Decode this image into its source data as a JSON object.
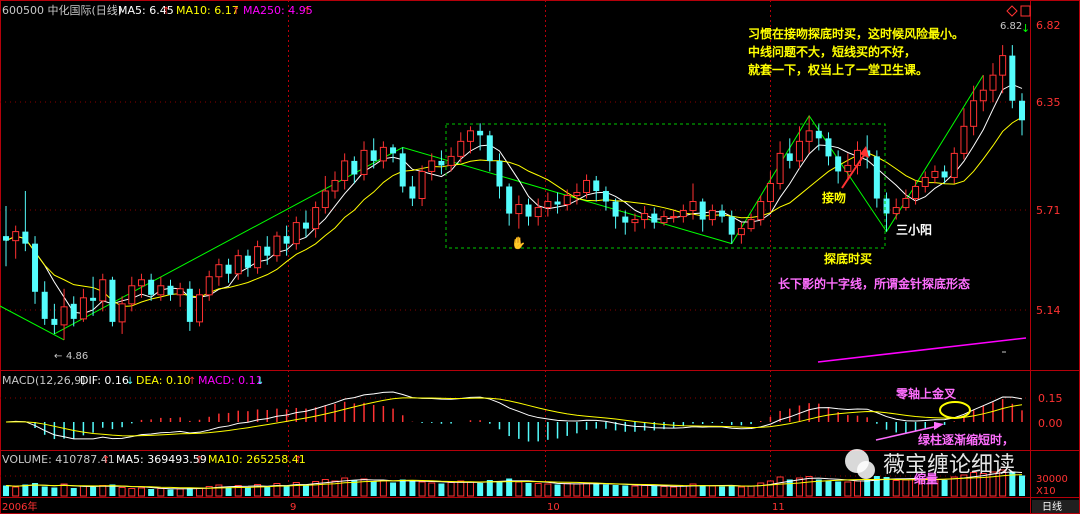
{
  "header": {
    "code_name": "600500 中化国际(日线)",
    "ma5": "MA5: 6.45",
    "ma10": "MA10: 6.17",
    "ma250": "MA250: 4.95"
  },
  "price_axis": [
    "6.82",
    "6.35",
    "5.71",
    "5.14"
  ],
  "low_label": "4.86",
  "annotations": {
    "note_lines": [
      "习惯在接吻探底时买，这时候风险最小。",
      "中线问题不大，短线买的不好，",
      "就套一下，权当上了一堂卫生课。"
    ],
    "kiss": "接吻",
    "three_small_yang": "三小阳",
    "bottom_buy": "探底时买",
    "doji_note": "长下影的十字线，所谓金针探底形态",
    "zero_axis_cross": "零轴上金叉",
    "green_shrink": "绿柱逐渐缩短时，",
    "shrink_volume": "缩量",
    "watermark": "薇宝缠论细读"
  },
  "macd": {
    "title": "MACD(12,26,9)",
    "dif": "DIF: 0.16",
    "dea": "DEA: 0.10",
    "macd": "MACD: 0.11",
    "axis": [
      "0.15",
      "0.00"
    ]
  },
  "volume": {
    "title": "VOLUME: 410787.41",
    "ma5": "MA5: 369493.59",
    "ma10": "MA10: 265258.41",
    "axis": [
      "30000",
      "X10"
    ]
  },
  "months": [
    "2006年",
    "9",
    "10",
    "11"
  ],
  "period": "日线",
  "colors": {
    "up": "#ff3232",
    "down": "#54fcfc",
    "ma5": "#ffffff",
    "ma10": "#ffff00",
    "ma250": "#ff00ff",
    "trend": "#00ff00",
    "annot": "#ffff00",
    "pink": "#ff6eff"
  },
  "chart_data": {
    "type": "candlestick",
    "ylim": [
      4.7,
      7.0
    ],
    "candles": [
      [
        5.55,
        5.52,
        5.75,
        5.35
      ],
      [
        5.52,
        5.58,
        5.62,
        5.4
      ],
      [
        5.58,
        5.5,
        5.85,
        5.45
      ],
      [
        5.5,
        5.18,
        5.55,
        5.1
      ],
      [
        5.18,
        5.0,
        5.25,
        4.96
      ],
      [
        5.0,
        4.96,
        5.1,
        4.9
      ],
      [
        4.96,
        5.08,
        5.2,
        4.86
      ],
      [
        5.1,
        5.0,
        5.15,
        4.95
      ],
      [
        5.0,
        5.14,
        5.2,
        4.98
      ],
      [
        5.14,
        5.12,
        5.28,
        5.02
      ],
      [
        5.12,
        5.26,
        5.3,
        5.05
      ],
      [
        5.26,
        4.98,
        5.28,
        4.95
      ],
      [
        4.98,
        5.1,
        5.15,
        4.9
      ],
      [
        5.1,
        5.22,
        5.28,
        5.05
      ],
      [
        5.22,
        5.26,
        5.3,
        5.14
      ],
      [
        5.26,
        5.16,
        5.3,
        5.12
      ],
      [
        5.16,
        5.22,
        5.28,
        5.12
      ],
      [
        5.22,
        5.16,
        5.26,
        5.12
      ],
      [
        5.16,
        5.2,
        5.24,
        5.08
      ],
      [
        5.2,
        4.98,
        5.25,
        4.92
      ],
      [
        4.98,
        5.16,
        5.2,
        4.95
      ],
      [
        5.16,
        5.28,
        5.32,
        5.12
      ],
      [
        5.28,
        5.36,
        5.4,
        5.22
      ],
      [
        5.36,
        5.3,
        5.4,
        5.24
      ],
      [
        5.3,
        5.42,
        5.46,
        5.26
      ],
      [
        5.42,
        5.34,
        5.46,
        5.28
      ],
      [
        5.34,
        5.48,
        5.52,
        5.3
      ],
      [
        5.48,
        5.42,
        5.55,
        5.36
      ],
      [
        5.42,
        5.55,
        5.58,
        5.38
      ],
      [
        5.55,
        5.5,
        5.62,
        5.42
      ],
      [
        5.5,
        5.64,
        5.68,
        5.46
      ],
      [
        5.64,
        5.6,
        5.72,
        5.54
      ],
      [
        5.6,
        5.74,
        5.78,
        5.54
      ],
      [
        5.74,
        5.85,
        5.95,
        5.7
      ],
      [
        5.85,
        5.92,
        5.98,
        5.8
      ],
      [
        5.92,
        6.05,
        6.1,
        5.86
      ],
      [
        6.05,
        5.96,
        6.08,
        5.9
      ],
      [
        5.96,
        6.12,
        6.18,
        5.92
      ],
      [
        6.12,
        6.05,
        6.2,
        6.0
      ],
      [
        6.05,
        6.14,
        6.18,
        6.0
      ],
      [
        6.14,
        6.1,
        6.16,
        6.04
      ],
      [
        6.1,
        5.88,
        6.14,
        5.84
      ],
      [
        5.88,
        5.8,
        5.95,
        5.75
      ],
      [
        5.8,
        5.98,
        6.02,
        5.75
      ],
      [
        5.98,
        6.05,
        6.1,
        5.92
      ],
      [
        6.05,
        6.02,
        6.12,
        5.96
      ],
      [
        6.02,
        6.08,
        6.14,
        5.98
      ],
      [
        6.08,
        6.18,
        6.24,
        6.04
      ],
      [
        6.18,
        6.25,
        6.28,
        6.1
      ],
      [
        6.25,
        6.22,
        6.3,
        6.12
      ],
      [
        6.22,
        6.05,
        6.25,
        5.98
      ],
      [
        6.05,
        5.88,
        6.1,
        5.8
      ],
      [
        5.88,
        5.7,
        5.9,
        5.62
      ],
      [
        5.7,
        5.76,
        5.82,
        5.6
      ],
      [
        5.76,
        5.68,
        5.8,
        5.62
      ],
      [
        5.68,
        5.74,
        5.8,
        5.62
      ],
      [
        5.74,
        5.78,
        5.84,
        5.68
      ],
      [
        5.78,
        5.76,
        5.84,
        5.7
      ],
      [
        5.76,
        5.82,
        5.86,
        5.72
      ],
      [
        5.82,
        5.84,
        5.9,
        5.76
      ],
      [
        5.84,
        5.92,
        5.96,
        5.8
      ],
      [
        5.92,
        5.85,
        5.95,
        5.78
      ],
      [
        5.85,
        5.78,
        5.88,
        5.72
      ],
      [
        5.78,
        5.68,
        5.8,
        5.6
      ],
      [
        5.68,
        5.64,
        5.72,
        5.56
      ],
      [
        5.64,
        5.66,
        5.7,
        5.58
      ],
      [
        5.66,
        5.7,
        5.75,
        5.6
      ],
      [
        5.7,
        5.64,
        5.74,
        5.6
      ],
      [
        5.64,
        5.68,
        5.72,
        5.62
      ],
      [
        5.68,
        5.68,
        5.72,
        5.64
      ],
      [
        5.68,
        5.72,
        5.76,
        5.64
      ],
      [
        5.72,
        5.78,
        5.9,
        5.66
      ],
      [
        5.78,
        5.66,
        5.8,
        5.58
      ],
      [
        5.66,
        5.72,
        5.76,
        5.62
      ],
      [
        5.72,
        5.68,
        5.76,
        5.64
      ],
      [
        5.68,
        5.56,
        5.72,
        5.5
      ],
      [
        5.56,
        5.6,
        5.64,
        5.5
      ],
      [
        5.6,
        5.66,
        5.7,
        5.58
      ],
      [
        5.66,
        5.78,
        5.82,
        5.62
      ],
      [
        5.78,
        5.9,
        5.98,
        5.72
      ],
      [
        5.9,
        6.1,
        6.18,
        5.86
      ],
      [
        6.1,
        6.05,
        6.2,
        6.0
      ],
      [
        6.05,
        6.18,
        6.28,
        6.0
      ],
      [
        6.18,
        6.25,
        6.35,
        6.1
      ],
      [
        6.25,
        6.2,
        6.3,
        6.12
      ],
      [
        6.2,
        6.08,
        6.24,
        6.02
      ],
      [
        6.08,
        5.98,
        6.12,
        5.9
      ],
      [
        5.98,
        6.02,
        6.1,
        5.92
      ],
      [
        6.02,
        6.12,
        6.18,
        5.96
      ],
      [
        6.12,
        6.08,
        6.22,
        6.0
      ],
      [
        6.08,
        5.8,
        6.12,
        5.74
      ],
      [
        5.8,
        5.7,
        5.84,
        5.58
      ],
      [
        5.7,
        5.74,
        5.8,
        5.66
      ],
      [
        5.74,
        5.8,
        5.86,
        5.72
      ],
      [
        5.8,
        5.88,
        5.92,
        5.76
      ],
      [
        5.88,
        5.94,
        5.98,
        5.84
      ],
      [
        5.94,
        5.98,
        6.02,
        5.9
      ],
      [
        5.98,
        5.94,
        6.02,
        5.9
      ],
      [
        5.94,
        6.1,
        6.14,
        5.9
      ],
      [
        6.1,
        6.28,
        6.4,
        6.06
      ],
      [
        6.28,
        6.45,
        6.55,
        6.22
      ],
      [
        6.45,
        6.52,
        6.62,
        6.38
      ],
      [
        6.52,
        6.62,
        6.7,
        6.44
      ],
      [
        6.62,
        6.75,
        6.82,
        6.5
      ],
      [
        6.75,
        6.45,
        6.82,
        6.4
      ],
      [
        6.45,
        6.32,
        6.5,
        6.22
      ]
    ],
    "volume": [
      210,
      180,
      230,
      260,
      190,
      170,
      240,
      160,
      200,
      180,
      210,
      230,
      170,
      150,
      160,
      140,
      150,
      130,
      140,
      170,
      160,
      190,
      220,
      180,
      210,
      170,
      230,
      190,
      250,
      200,
      270,
      230,
      290,
      330,
      300,
      360,
      310,
      340,
      290,
      300,
      270,
      330,
      310,
      280,
      260,
      250,
      270,
      300,
      280,
      260,
      320,
      300,
      350,
      280,
      260,
      250,
      240,
      230,
      250,
      240,
      260,
      250,
      230,
      220,
      210,
      200,
      210,
      200,
      190,
      180,
      200,
      240,
      220,
      200,
      190,
      210,
      180,
      200,
      260,
      300,
      380,
      330,
      360,
      390,
      330,
      310,
      290,
      280,
      300,
      320,
      400,
      380,
      310,
      320,
      340,
      350,
      330,
      320,
      380,
      420,
      470,
      450,
      480,
      520,
      490,
      410
    ],
    "macd_note": "DIF 0.16, DEA 0.10, MACD 0.11"
  }
}
